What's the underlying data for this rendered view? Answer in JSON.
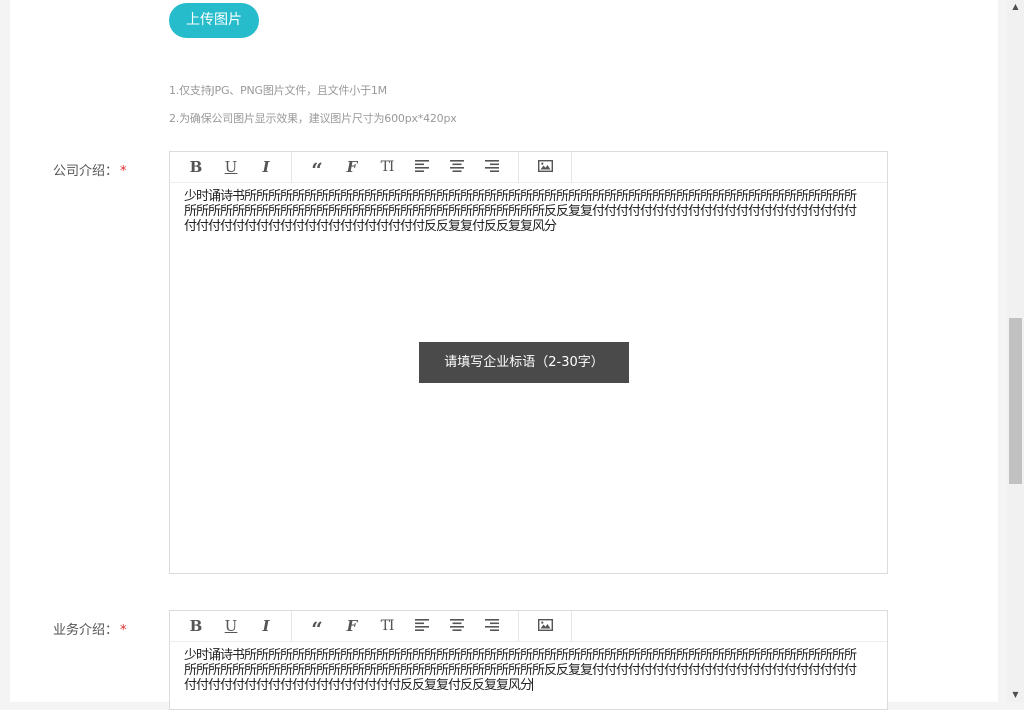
{
  "upload": {
    "button_label": "上传图片"
  },
  "hints": [
    "1.仅支持JPG、PNG图片文件，且文件小于1M",
    "2.为确保公司图片显示效果，建议图片尺寸为600px*420px"
  ],
  "company_intro": {
    "label": "公司介绍：",
    "required_mark": "*",
    "content": "少时诵诗书所所所所所所所所所所所所所所所所所所所所所所所所所所所所所所所所所所所所所所所所所所所所所所所所所所所所所所所所所所所所所所所所所所所所所所所所所所所所所所所所所反反复复付付付付付付付付付付付付付付付付付付付付付付付付付付付付付付付付付付付付付付付付付付反反复复付反反复复风分"
  },
  "business_intro": {
    "label": "业务介绍：",
    "required_mark": "*",
    "content": "少时诵诗书所所所所所所所所所所所所所所所所所所所所所所所所所所所所所所所所所所所所所所所所所所所所所所所所所所所所所所所所所所所所所所所所所所所所所所所所所所所所所所所所所反反复复付付付付付付付付付付付付付付付付付付付付付付付付付付付付付付付付付付付付付付付付反反复复付反反复复风分"
  },
  "toolbar": {
    "bold": "B",
    "underline": "U",
    "italic": "I",
    "quote": "“",
    "font": "F",
    "font_size": "TI",
    "icons": [
      "bold-icon",
      "underline-icon",
      "italic-icon",
      "quote-icon",
      "font-family-icon",
      "font-size-icon",
      "align-left-icon",
      "align-center-icon",
      "align-right-icon",
      "image-icon"
    ]
  },
  "tooltip": {
    "text": "请填写企业标语（2-30字）"
  },
  "colors": {
    "accent": "#26bccc",
    "required": "#e02b2b",
    "tooltip_bg": "#4a4a4a"
  }
}
